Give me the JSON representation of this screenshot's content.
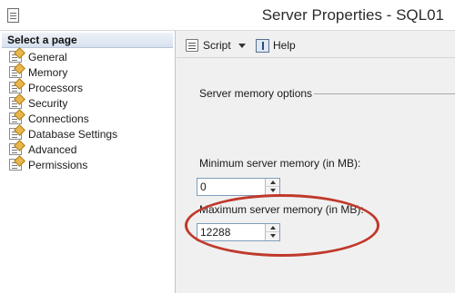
{
  "window": {
    "title": "Server Properties - SQL01"
  },
  "left_pane": {
    "header": "Select a page",
    "items": [
      {
        "label": "General",
        "icon": "page-icon"
      },
      {
        "label": "Memory",
        "icon": "page-icon"
      },
      {
        "label": "Processors",
        "icon": "page-icon"
      },
      {
        "label": "Security",
        "icon": "page-icon"
      },
      {
        "label": "Connections",
        "icon": "page-icon"
      },
      {
        "label": "Database Settings",
        "icon": "page-icon"
      },
      {
        "label": "Advanced",
        "icon": "page-icon"
      },
      {
        "label": "Permissions",
        "icon": "page-icon"
      }
    ]
  },
  "toolbar": {
    "script_label": "Script",
    "help_label": "Help"
  },
  "memory": {
    "section_label": "Server memory options",
    "min_label": "Minimum server memory (in MB):",
    "min_value": "0",
    "max_label": "Maximum server memory (in MB):",
    "max_value": "12288"
  },
  "colors": {
    "highlight": "#c0392b",
    "header_bg": "#d7e1ef",
    "field_border": "#7f9db9"
  }
}
